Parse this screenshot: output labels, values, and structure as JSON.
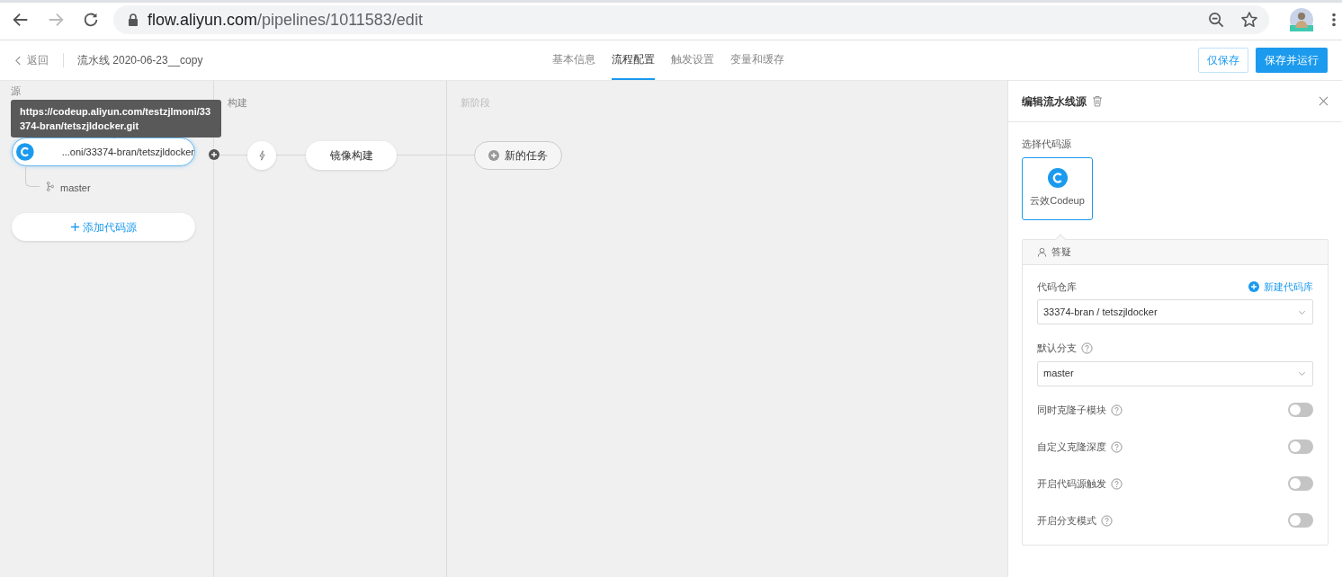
{
  "browser": {
    "url_host": "flow.aliyun.com",
    "url_path": "/pipelines/1011583/edit"
  },
  "header": {
    "back": "返回",
    "title": "流水线 2020-06-23__copy",
    "tabs": [
      {
        "label": "基本信息",
        "selected": false
      },
      {
        "label": "流程配置",
        "selected": true
      },
      {
        "label": "触发设置",
        "selected": false
      },
      {
        "label": "变量和缓存",
        "selected": false
      }
    ],
    "save": "仅保存",
    "save_run": "保存并运行"
  },
  "stages": [
    {
      "title": "源"
    },
    {
      "title": "构建"
    },
    {
      "title": "新阶段"
    }
  ],
  "source": {
    "label": "...oni/33374-bran/tetszjldocker",
    "branch": "master",
    "tooltip": "https://codeup.aliyun.com/testzjlmoni/33374-bran/tetszjldocker.git",
    "selected": true
  },
  "add_source": "添加代码源",
  "build_job": "镜像构建",
  "new_task": "新的任务",
  "panel": {
    "title": "编辑流水线源",
    "select_label": "选择代码源",
    "options": [
      {
        "label": "云效Codeup",
        "selected": true
      }
    ],
    "account": "答疑",
    "repo_label": "代码仓库",
    "new_repo": "新建代码库",
    "repo_value": "33374-bran / tetszjldocker",
    "branch_label": "默认分支",
    "branch_value": "master",
    "toggles": [
      {
        "label": "同时克隆子模块",
        "on": false
      },
      {
        "label": "自定义克隆深度",
        "on": false
      },
      {
        "label": "开启代码源触发",
        "on": false
      },
      {
        "label": "开启分支模式",
        "on": false
      }
    ]
  }
}
